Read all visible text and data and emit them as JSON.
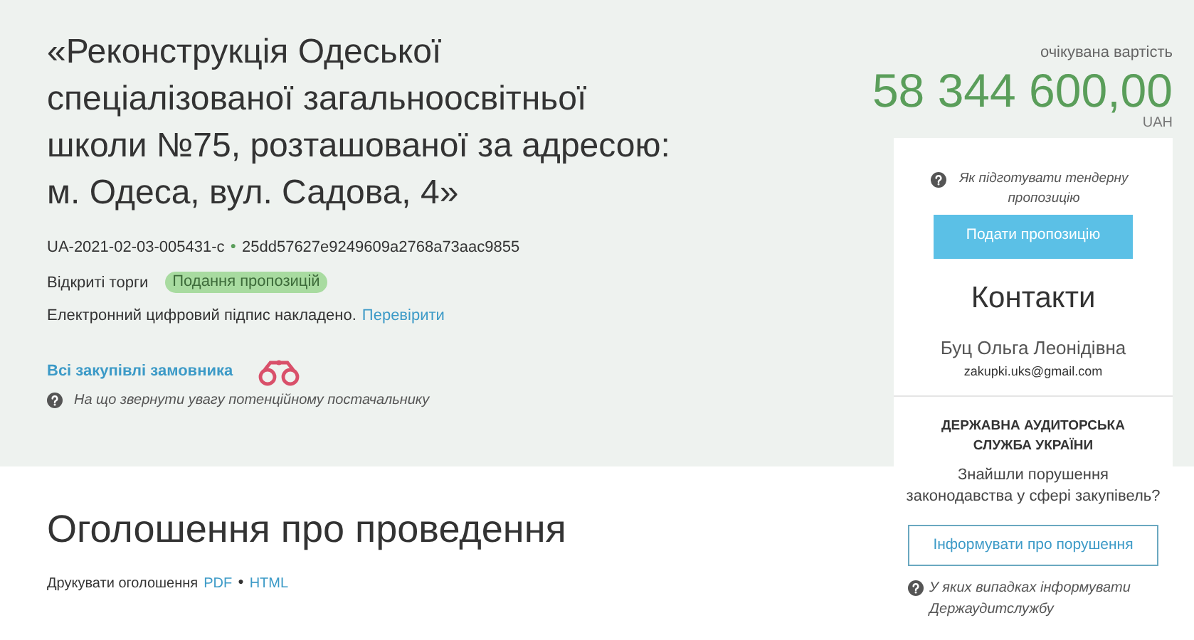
{
  "title": "«Реконструкція Одеської спеціалізованої загальноосвітньої школи №75, розташованої за адресою: м. Одеса, вул. Садова, 4»",
  "tender_id": "UA-2021-02-03-005431-c",
  "id_separator": "●",
  "hash": "25dd57627e9249609a2768a73aac9855",
  "procedure": "Відкриті торги",
  "status_badge": "Подання пропозицій",
  "signature": {
    "text": "Електронний цифровий підпис накладено.",
    "link": "Перевірити"
  },
  "customer_link": "Всі закупівлі замовника",
  "hint": "На що звернути увагу потенційному постачальнику",
  "expected_value": {
    "label": "очікувана вартість",
    "amount": "58 344 600,00",
    "currency": "UAH"
  },
  "card": {
    "help": "Як підготувати тендерну пропозицію",
    "submit_button": "Подати пропозицію",
    "contacts_title": "Контакти",
    "contact_name": "Буц Ольга Леонідівна",
    "contact_email": "zakupki.uks@gmail.com"
  },
  "audit": {
    "title": "ДЕРЖАВНА АУДИТОРСЬКА СЛУЖБА УКРАЇНИ",
    "question": "Знайшли порушення законодавства у сфері закупівель?",
    "button": "Інформувати про порушення",
    "help": "У яких випадках інформувати Держаудитслужбу"
  },
  "announcement": {
    "title": "Оголошення про проведення",
    "print_label": "Друкувати оголошення",
    "links": [
      "PDF",
      "HTML"
    ],
    "separator": "●"
  }
}
